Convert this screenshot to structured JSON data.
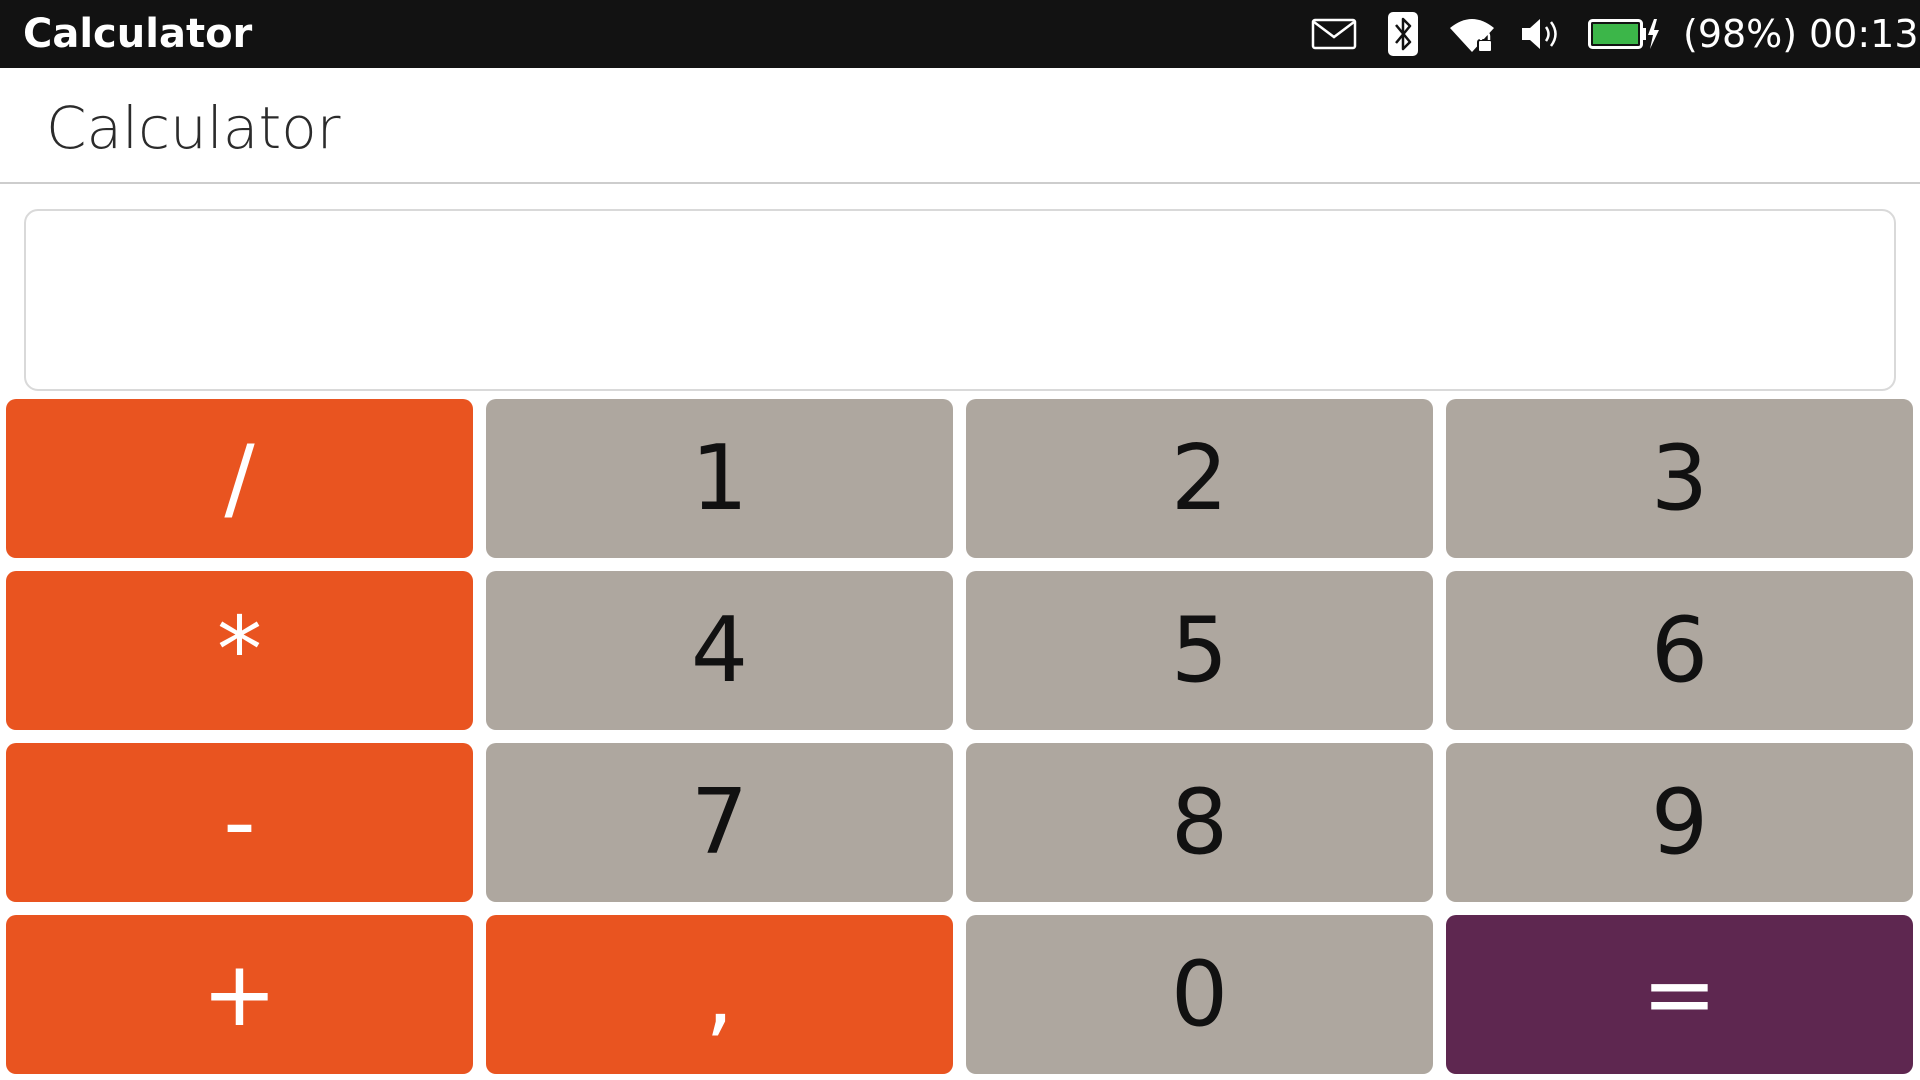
{
  "status_bar": {
    "app_title": "Calculator",
    "icons": [
      "mail-icon",
      "bluetooth-icon",
      "wifi-icon",
      "volume-icon",
      "battery-icon"
    ],
    "battery_percent": "(98%)",
    "battery_level": 0.98,
    "time": "00:13"
  },
  "header": {
    "title": "Calculator"
  },
  "display": {
    "value": ""
  },
  "keypad": {
    "rows": [
      [
        "/",
        "1",
        "2",
        "3"
      ],
      [
        "*",
        "4",
        "5",
        "6"
      ],
      [
        "-",
        "7",
        "8",
        "9"
      ],
      [
        "+",
        ",",
        "0",
        "="
      ]
    ]
  },
  "colors": {
    "operator": "#e95420",
    "digit": "#aea79f",
    "equals": "#5e2750",
    "status_bar": "#121212",
    "battery_fill": "#3cb649"
  }
}
